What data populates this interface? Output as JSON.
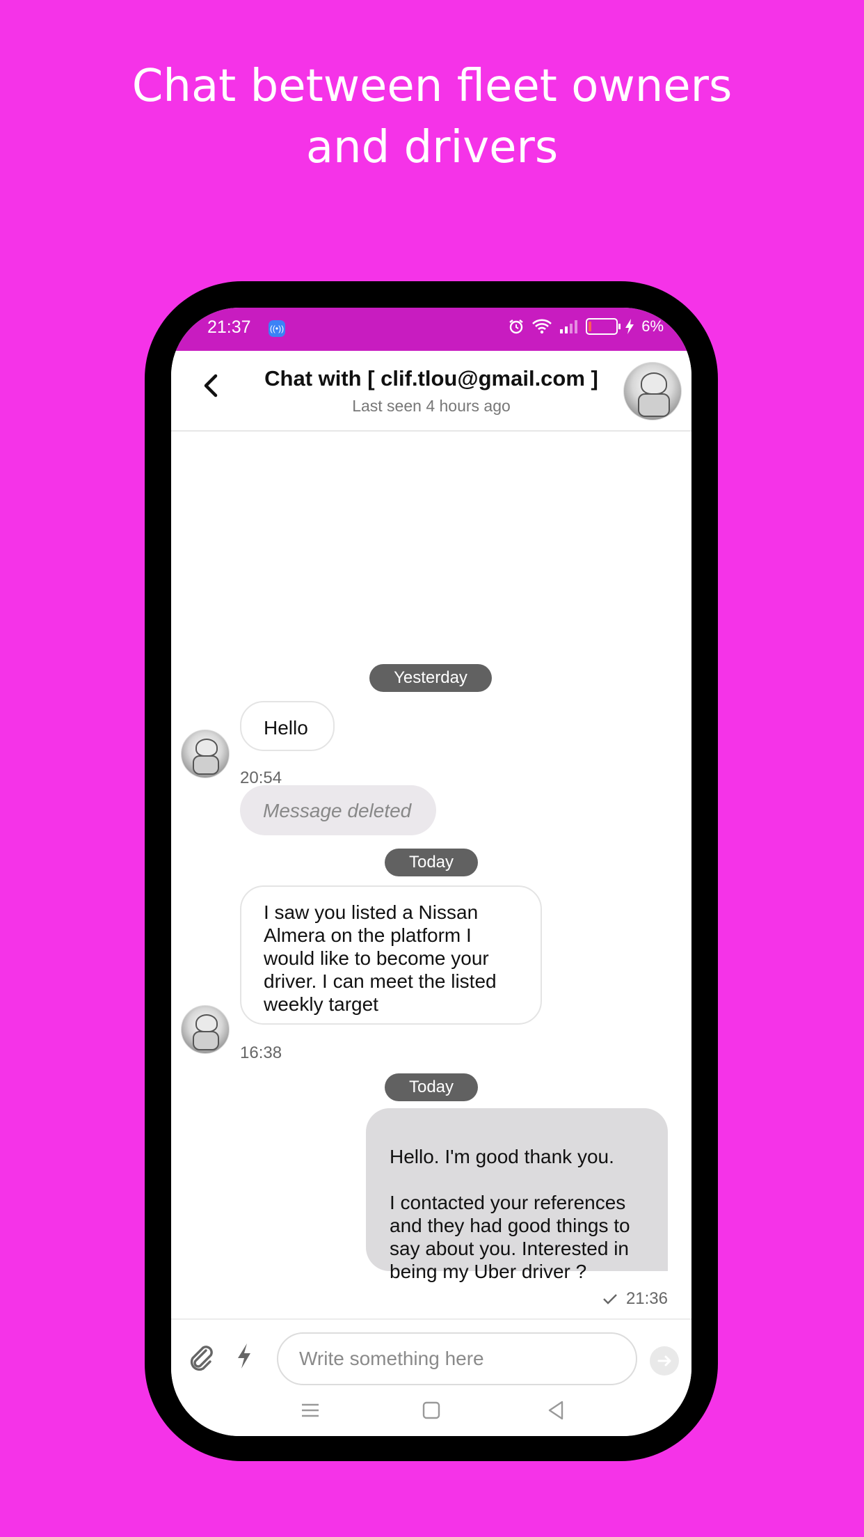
{
  "headline": {
    "line1": "Chat between fleet owners",
    "line2": "and drivers"
  },
  "status_bar": {
    "time": "21:37",
    "battery": "6%",
    "icons": [
      "app-notification-icon",
      "alarm-icon",
      "wifi-icon",
      "signal-icon",
      "battery-icon",
      "charging-icon"
    ]
  },
  "chat_header": {
    "title": "Chat with [ clif.tlou@gmail.com ]",
    "subtitle": "Last seen 4 hours ago"
  },
  "messages": [
    {
      "type": "day",
      "label": "Yesterday"
    },
    {
      "type": "incoming",
      "text": "Hello"
    },
    {
      "type": "time",
      "text": "20:54"
    },
    {
      "type": "deleted",
      "text": "Message deleted"
    },
    {
      "type": "day",
      "label": "Today"
    },
    {
      "type": "incoming",
      "text": "I saw you listed a Nissan Almera on the platform I would like to become your driver. I can meet the listed weekly target"
    },
    {
      "type": "time",
      "text": "16:38"
    },
    {
      "type": "day",
      "label": "Today"
    },
    {
      "type": "outgoing",
      "text": "Hello. I'm good thank you.\n\nI contacted your references and they had good things to say about you. Interested in being my Uber driver ?"
    },
    {
      "type": "time",
      "text": "21:36",
      "status": "sent-check"
    }
  ],
  "composer": {
    "placeholder": "Write something here"
  },
  "colors": {
    "background": "#f533e8",
    "status_bar": "#c81cc0",
    "day_pill": "#616161",
    "outgoing_bubble": "#dcdbdd",
    "deleted_bubble": "#ebe8ec"
  }
}
